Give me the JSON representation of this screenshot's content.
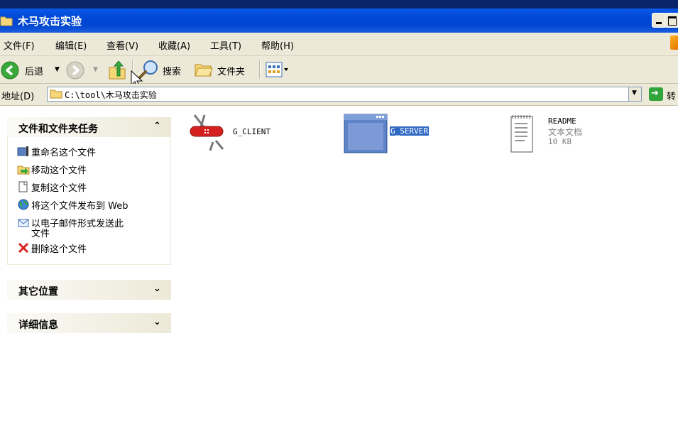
{
  "window": {
    "title": "木马攻击实验"
  },
  "menu": [
    "文件(F)",
    "编辑(E)",
    "查看(V)",
    "收藏(A)",
    "工具(T)",
    "帮助(H)"
  ],
  "toolbar": {
    "back": "后退",
    "search": "搜索",
    "folders": "文件夹"
  },
  "address": {
    "label": "地址(D)",
    "value": "C:\\tool\\木马攻击实验",
    "go": "转"
  },
  "task_pane": {
    "file_tasks": {
      "title": "文件和文件夹任务",
      "items": [
        {
          "label": "重命名这个文件",
          "icon": "rename-icon"
        },
        {
          "label": "移动这个文件",
          "icon": "move-icon"
        },
        {
          "label": "复制这个文件",
          "icon": "copy-icon"
        },
        {
          "label": "将这个文件发布到 Web",
          "icon": "publish-web-icon"
        },
        {
          "label": "以电子邮件形式发送此",
          "label2": "文件",
          "icon": "email-icon"
        },
        {
          "label": "删除这个文件",
          "icon": "delete-icon"
        }
      ]
    },
    "other_places": {
      "title": "其它位置"
    },
    "details": {
      "title": "详细信息"
    }
  },
  "files": [
    {
      "name": "G_CLIENT",
      "icon": "swiss-knife-icon"
    },
    {
      "name": "G_SERVER",
      "icon": "application-window-icon",
      "selected": true
    },
    {
      "name": "README",
      "type": "文本文档",
      "size": "10 KB",
      "icon": "text-document-icon"
    }
  ],
  "colors": {
    "titlebar": "#0047d5",
    "chrome": "#ece9d8",
    "selection": "#316ac5"
  }
}
